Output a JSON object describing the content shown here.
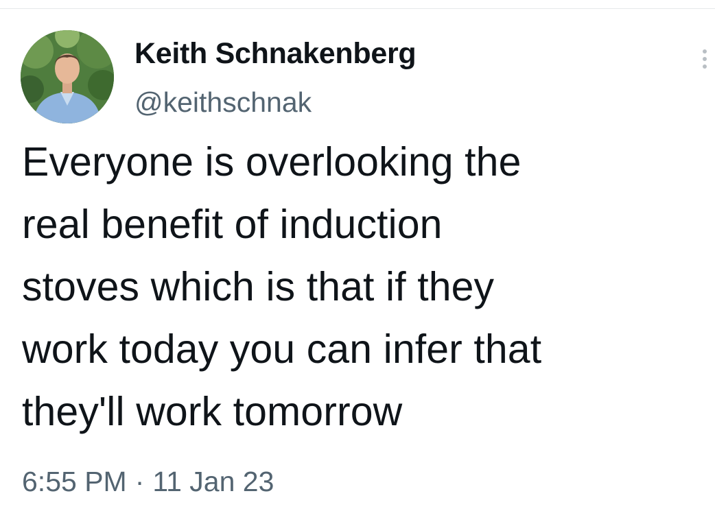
{
  "author": {
    "name": "Keith Schnakenberg",
    "handle": "@keithschnak",
    "avatar_icon": "profile-photo-icon"
  },
  "tweet": {
    "lines": [
      "Everyone is overlooking the",
      "real benefit of induction",
      "stoves which is that if they",
      "work today you can infer that",
      "they'll work tomorrow"
    ],
    "time": "6:55 PM",
    "separator": "·",
    "date": "11 Jan 23"
  },
  "actions": {
    "more_icon": "more-vertical-icon"
  },
  "colors": {
    "text_primary": "#0f1419",
    "text_secondary": "#536471",
    "icon_muted": "#b9bfc4"
  }
}
